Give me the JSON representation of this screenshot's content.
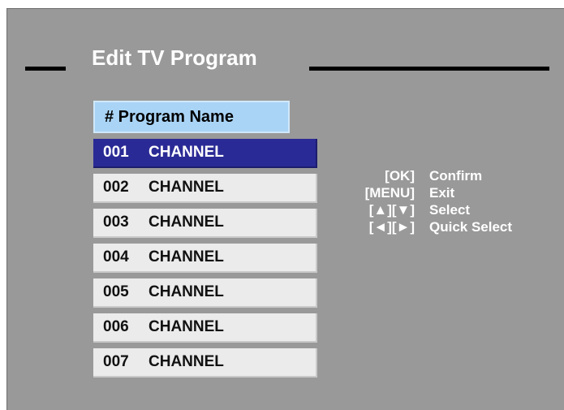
{
  "title": "Edit TV Program",
  "header": {
    "label": "# Program Name"
  },
  "programs": [
    {
      "number": "001",
      "name": "CHANNEL",
      "selected": true
    },
    {
      "number": "002",
      "name": "CHANNEL",
      "selected": false
    },
    {
      "number": "003",
      "name": "CHANNEL",
      "selected": false
    },
    {
      "number": "004",
      "name": "CHANNEL",
      "selected": false
    },
    {
      "number": "005",
      "name": "CHANNEL",
      "selected": false
    },
    {
      "number": "006",
      "name": "CHANNEL",
      "selected": false
    },
    {
      "number": "007",
      "name": "CHANNEL",
      "selected": false
    }
  ],
  "help": [
    {
      "key": "[OK]",
      "action": "Confirm"
    },
    {
      "key": "[MENU]",
      "action": "Exit"
    },
    {
      "key": "[▲][▼]",
      "action": "Select"
    },
    {
      "key": "[◄][►]",
      "action": "Quick Select"
    }
  ],
  "colors": {
    "background": "#999999",
    "selected_row": "#2a2a96",
    "row": "#ebebeb",
    "header": "#a9d4f6"
  }
}
